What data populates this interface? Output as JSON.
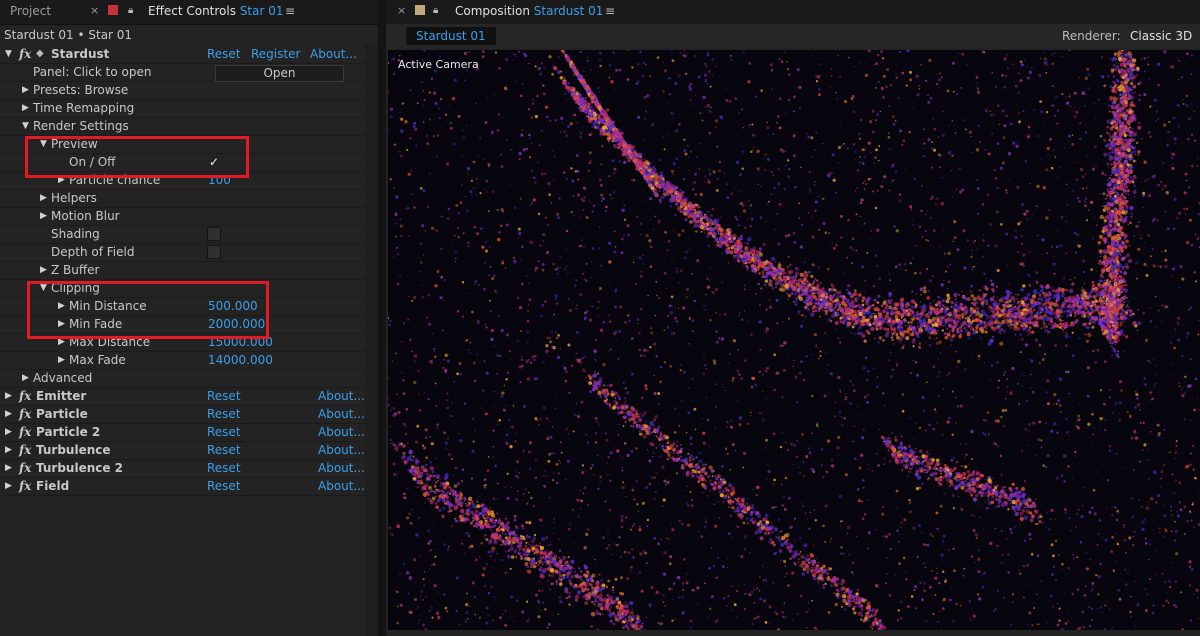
{
  "left_tabs": {
    "project": "Project",
    "effect_controls_label": "Effect Controls",
    "effect_controls_layer": "Star 01",
    "close": "×",
    "menu": "≡"
  },
  "layer_path": "Stardust 01 • Star 01",
  "stardust": {
    "name": "Stardust",
    "reset": "Reset",
    "register": "Register",
    "about": "About...",
    "panel_label": "Panel: Click to open",
    "open_button": "Open",
    "presets": "Presets: Browse",
    "time_remapping": "Time Remapping",
    "render_settings": "Render Settings",
    "preview": "Preview",
    "on_off": "On / Off",
    "on_off_checked": "✓",
    "particle_chance": "Particle chance",
    "particle_chance_value": "100",
    "helpers": "Helpers",
    "motion_blur": "Motion Blur",
    "shading": "Shading",
    "depth_of_field": "Depth of Field",
    "z_buffer": "Z Buffer",
    "clipping": "Clipping",
    "min_distance": "Min Distance",
    "min_distance_value": "500.000",
    "min_fade": "Min Fade",
    "min_fade_value": "2000.000",
    "max_distance": "Max Distance",
    "max_distance_value": "15000.000",
    "max_fade": "Max Fade",
    "max_fade_value": "14000.000",
    "advanced": "Advanced"
  },
  "effects": [
    {
      "name": "Emitter",
      "reset": "Reset",
      "about": "About..."
    },
    {
      "name": "Particle",
      "reset": "Reset",
      "about": "About..."
    },
    {
      "name": "Particle 2",
      "reset": "Reset",
      "about": "About..."
    },
    {
      "name": "Turbulence",
      "reset": "Reset",
      "about": "About..."
    },
    {
      "name": "Turbulence 2",
      "reset": "Reset",
      "about": "About..."
    },
    {
      "name": "Field",
      "reset": "Reset",
      "about": "About..."
    }
  ],
  "fx_symbol": "fx",
  "composition": {
    "close": "×",
    "label": "Composition",
    "name": "Stardust 01",
    "menu": "≡",
    "tab_chip": "Stardust 01",
    "renderer_label": "Renderer:",
    "renderer_value": "Classic 3D",
    "viewer_label": "Active Camera"
  },
  "colors": {
    "accent": "#3d9ee8",
    "highlight_box": "#e21a24",
    "effect_controls_swatch": "#c8323c",
    "composition_swatch": "#c2a878"
  },
  "icons": {
    "expand": "triangle-right-icon",
    "collapse": "triangle-down-icon",
    "lock": "lock-icon",
    "plugin": "cube-icon"
  }
}
